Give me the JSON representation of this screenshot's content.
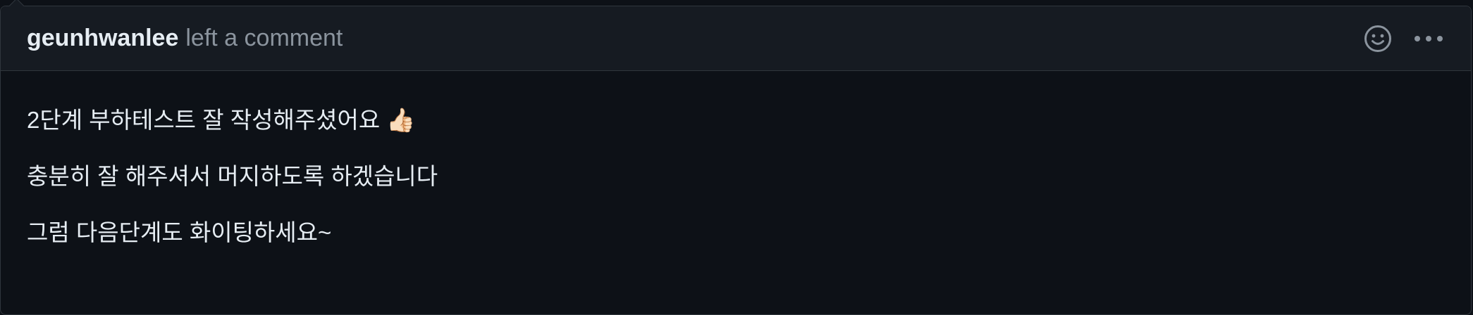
{
  "comment": {
    "author": "geunhwanlee",
    "action": "left a comment",
    "icons": {
      "reaction": "smiley-icon",
      "more": "kebab-horizontal-icon"
    },
    "paragraphs": [
      "2단계 부하테스트 잘 작성해주셨어요 👍🏻",
      "충분히 잘 해주셔서 머지하도록 하겠습니다",
      "그럼 다음단계도 화이팅하세요~"
    ]
  },
  "colors": {
    "background": "#0d1117",
    "header_background": "#161b22",
    "border": "#30363d",
    "text": "#e6edf3",
    "muted": "#8b949e"
  }
}
